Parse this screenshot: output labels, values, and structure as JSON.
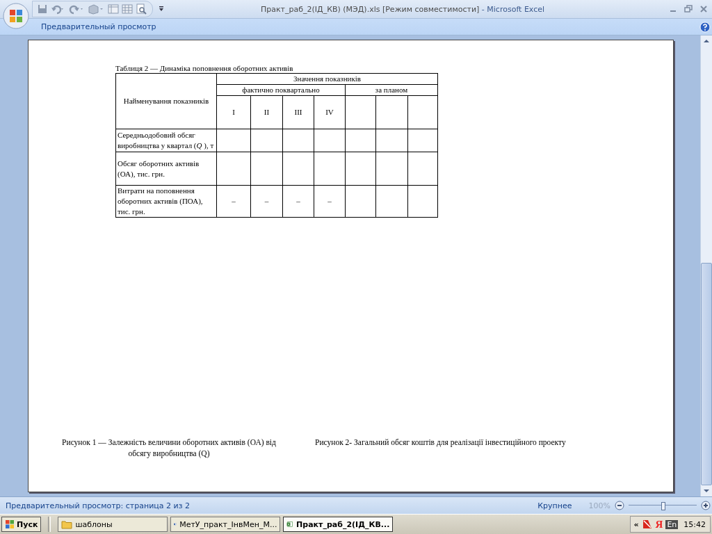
{
  "window": {
    "title": "Практ_раб_2(ІД_КВ) (МЭД).xls  [Режим совместимости]",
    "app_name": " - Microsoft Excel"
  },
  "ribbon": {
    "tab": "Предварительный просмотр"
  },
  "document": {
    "caption": "Таблиця 2 — Динаміка поповнення оборотних активів",
    "header": {
      "name": "Найменування показників",
      "group": "Значення показників",
      "actual": "фактично поквартально",
      "plan": "за планом",
      "quarters": [
        "I",
        "II",
        "III",
        "IV"
      ]
    },
    "rows": [
      {
        "name": "Середньодобовий обсяг виробництва у квартал (*Q* ), т"
      },
      {
        "name": "Обсяг оборотних активів (ОА), тис. грн."
      },
      {
        "name": "Витрати на поповнення оборотних активів (ПОА), тис. грн.",
        "quarters": [
          "–",
          "–",
          "–",
          "–"
        ]
      }
    ],
    "figures": [
      "Рисунок 1 — Залежність величини оборотних активів (ОА) від обсягу виробництва (Q)",
      "Рисунок 2- Загальний обсяг коштів для реалізації інвестиційного проекту"
    ]
  },
  "status_bar": {
    "text": "Предварительный просмотр: страница 2 из 2",
    "zoom_label": "Крупнее",
    "zoom_value": "100%",
    "zoom_disabled": true,
    "level": 0.5
  },
  "taskbar": {
    "start": "Пуск",
    "tasks": [
      {
        "label": "шаблоны",
        "kind": "folder",
        "selected": false
      },
      {
        "label": "МетУ_практ_ІнвМен_М...",
        "kind": "word",
        "selected": false
      },
      {
        "label": "Практ_раб_2(ІД_КВ...",
        "kind": "excel",
        "selected": true
      }
    ],
    "tray": {
      "expand": "«",
      "yandex": "Я",
      "language": "En",
      "clock": "15:42"
    }
  }
}
